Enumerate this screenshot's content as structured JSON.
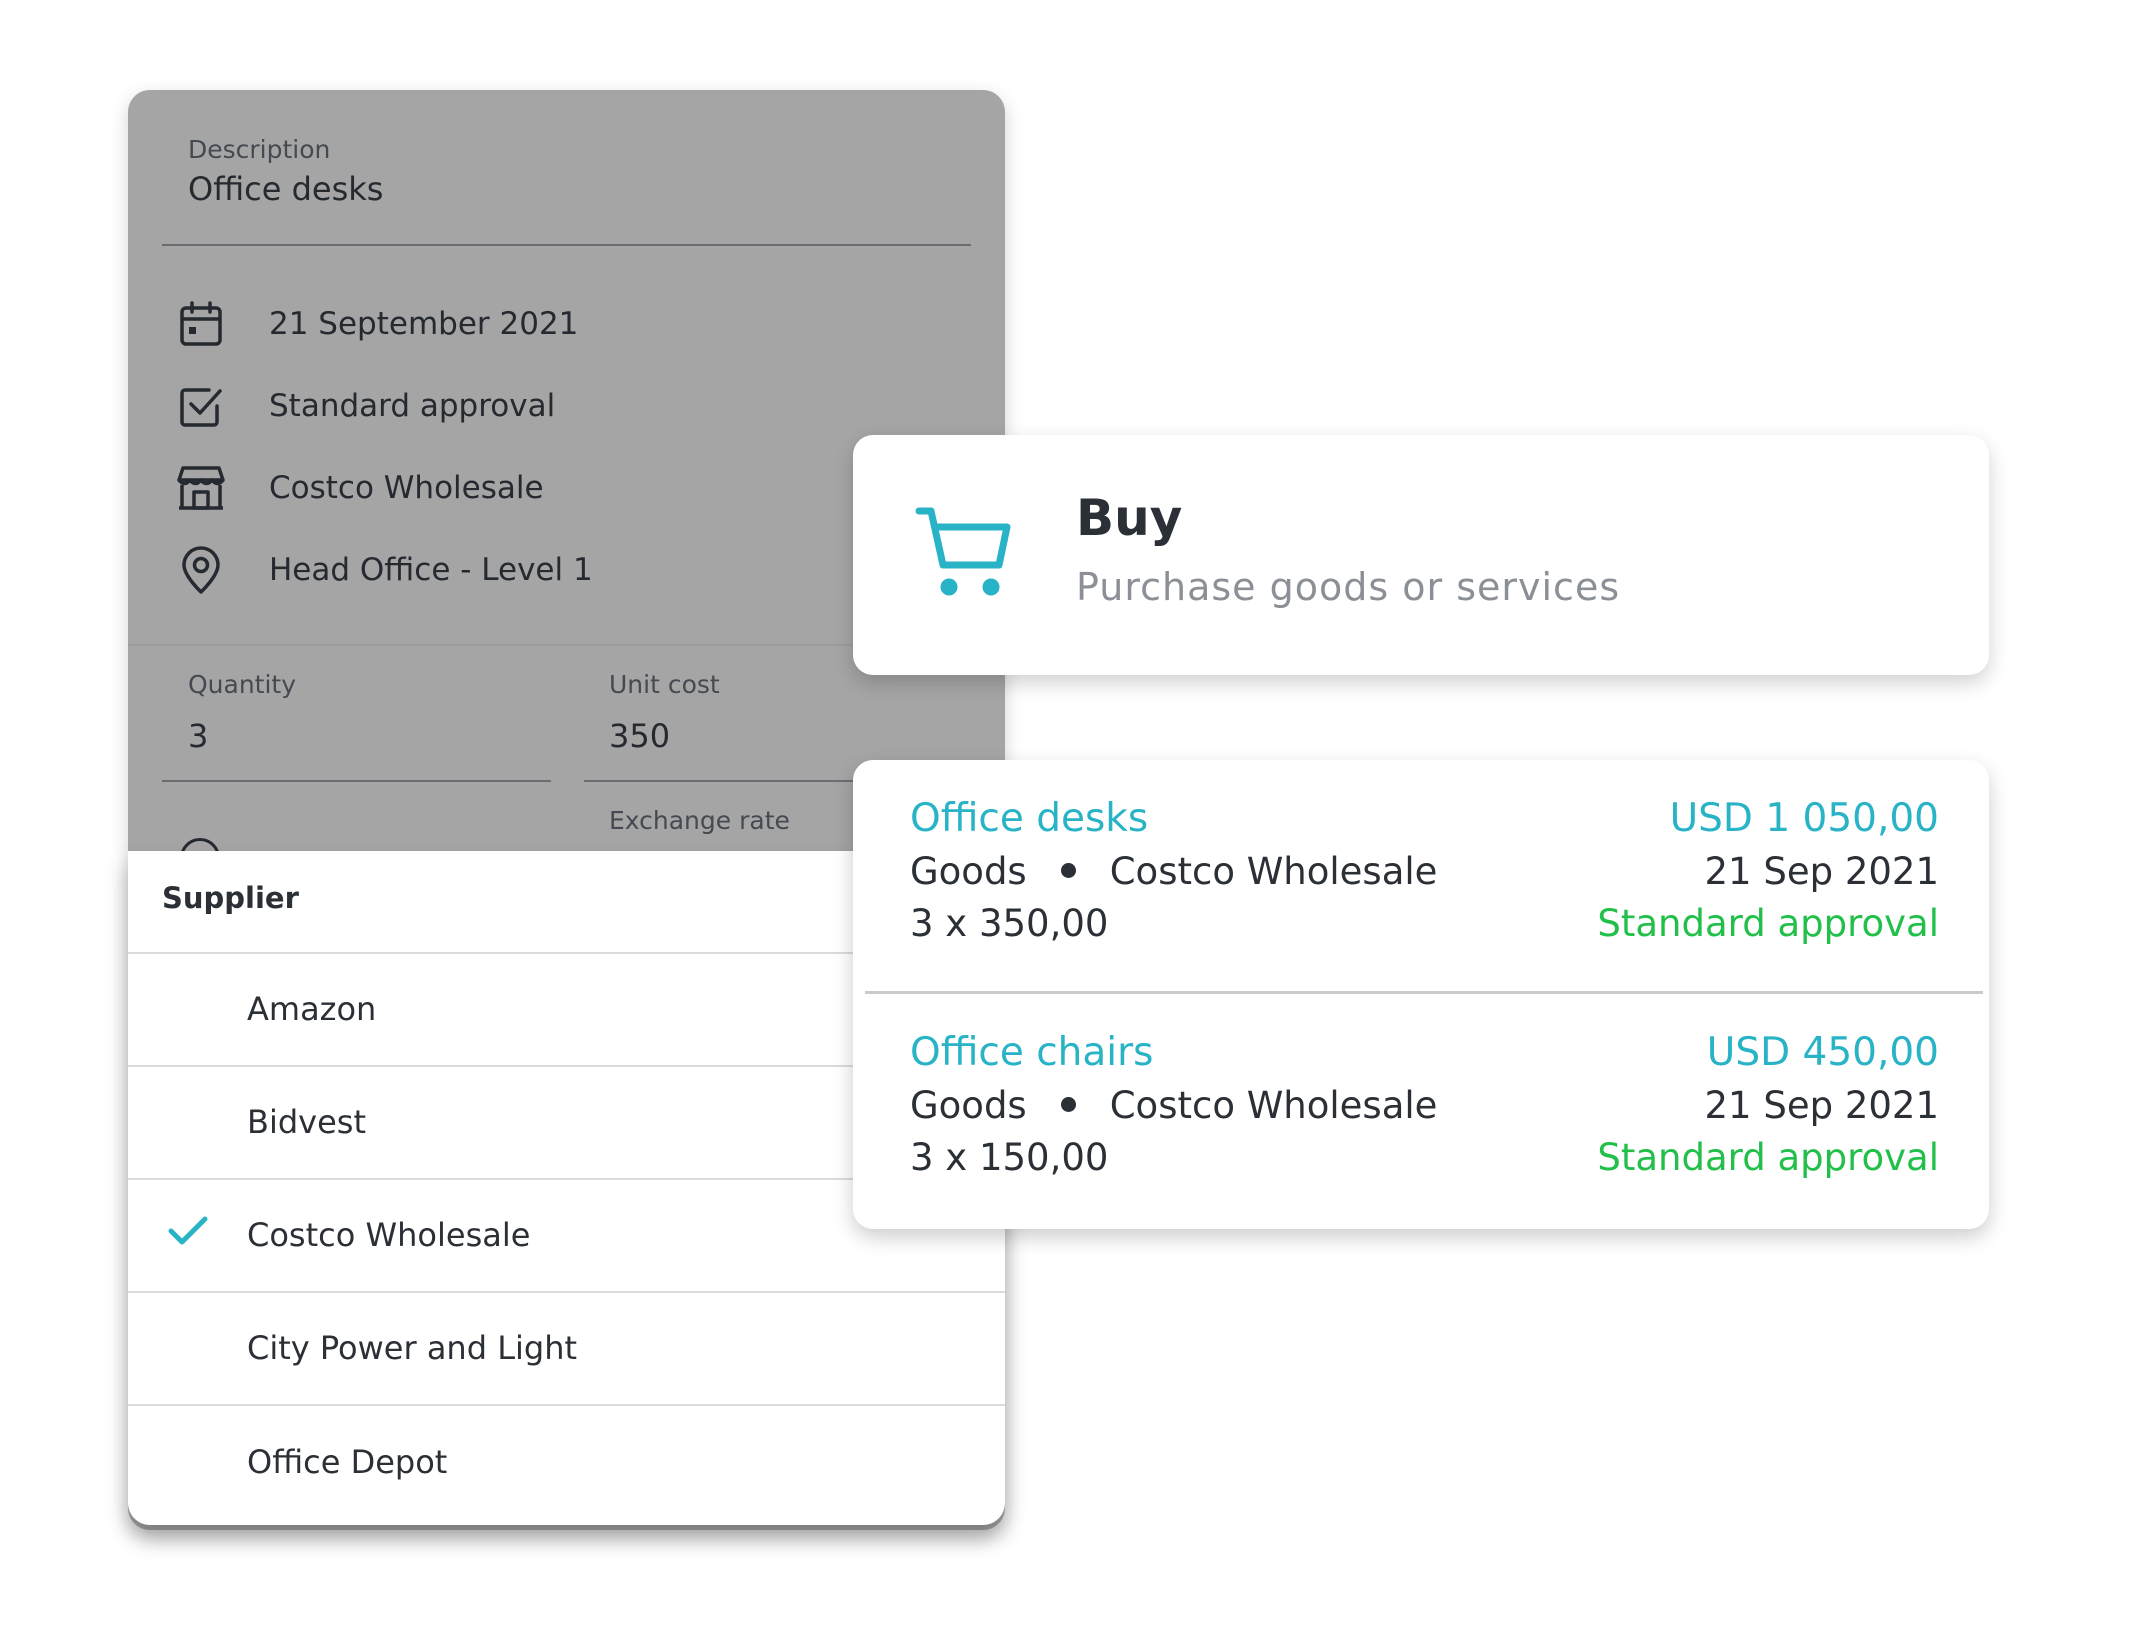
{
  "form": {
    "description_label": "Description",
    "description_value": "Office desks",
    "details": [
      {
        "icon": "calendar-icon",
        "text": "21 September 2021"
      },
      {
        "icon": "checkbox-icon",
        "text": "Standard approval"
      },
      {
        "icon": "store-icon",
        "text": "Costco Wholesale"
      },
      {
        "icon": "location-pin-icon",
        "text": "Head Office - Level 1"
      }
    ],
    "quantity_label": "Quantity",
    "quantity_value": "3",
    "unit_cost_label": "Unit cost",
    "unit_cost_value": "350",
    "exchange_rate_label": "Exchange rate"
  },
  "supplier_dropdown": {
    "header": "Supplier",
    "items": [
      {
        "label": "Amazon",
        "selected": false
      },
      {
        "label": "Bidvest",
        "selected": false
      },
      {
        "label": "Costco Wholesale",
        "selected": true
      },
      {
        "label": "City Power and Light",
        "selected": false
      },
      {
        "label": "Office Depot",
        "selected": false
      }
    ]
  },
  "buy_card": {
    "icon": "shopping-cart-icon",
    "title": "Buy",
    "subtitle": "Purchase goods or services"
  },
  "orders": [
    {
      "name": "Office desks",
      "type": "Goods",
      "supplier": "Costco Wholesale",
      "quantity_line": "3 x 350,00",
      "amount": "USD 1 050,00",
      "date": "21 Sep 2021",
      "status": "Standard approval"
    },
    {
      "name": "Office chairs",
      "type": "Goods",
      "supplier": "Costco Wholesale",
      "quantity_line": "3 x 150,00",
      "amount": "USD 450,00",
      "date": "21 Sep 2021",
      "status": "Standard approval"
    }
  ],
  "colors": {
    "accent": "#29b3c6",
    "status_green": "#22c04a",
    "dim_overlay": "#a5a5a5"
  }
}
